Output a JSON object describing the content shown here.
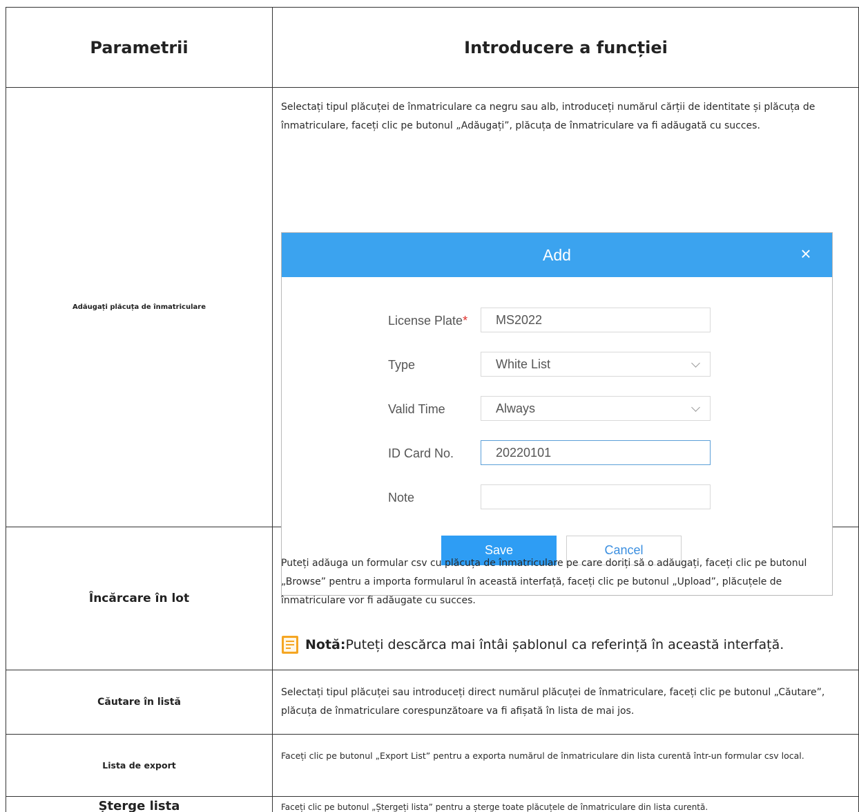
{
  "header": {
    "col1": "Parametrii",
    "col2": "Introducere a funcției"
  },
  "rows": [
    {
      "name": "Adăugați plăcuța de înmatriculare",
      "description": "Selectați tipul plăcuței de înmatriculare ca negru sau alb, introduceți numărul cărții de identitate și plăcuța de înmatriculare, faceți clic pe butonul „Adăugați”, plăcuța de înmatriculare va fi adăugată cu succes."
    },
    {
      "name": "Încărcare în lot",
      "description": "Puteți adăuga un formular csv cu plăcuța de înmatriculare pe care doriți să o adăugați, faceți clic pe butonul „Browse” pentru a importa formularul în această interfață, faceți clic pe butonul „Upload”, plăcuțele de înmatriculare vor fi adăugate cu succes.",
      "note_label": "Notă:",
      "note_text": "Puteți descărca mai întâi șablonul ca referință în această interfață."
    },
    {
      "name": "Căutare în listă",
      "description": "Selectați tipul plăcuței sau introduceți direct numărul plăcuței de înmatriculare, faceți clic pe butonul „Căutare”, plăcuța de înmatriculare corespunzătoare va fi afișată în lista de mai jos."
    },
    {
      "name": "Lista de export",
      "description": "Faceți clic pe butonul „Export List” pentru a exporta numărul de înmatriculare din lista curentă într-un formular csv local."
    },
    {
      "name": "Șterge lista",
      "description": "Faceți clic pe butonul „Ștergeți lista” pentru a șterge toate plăcuțele de înmatriculare din lista curentă."
    }
  ],
  "dialog": {
    "title": "Add",
    "close_icon": "×",
    "fields": [
      {
        "label": "License Plate",
        "required_mark": "*",
        "value": "MS2022"
      },
      {
        "label": "Type",
        "value": "White List"
      },
      {
        "label": "Valid Time",
        "value": "Always"
      },
      {
        "label": "ID Card No.",
        "value": "20220101"
      },
      {
        "label": "Note",
        "value": ""
      }
    ],
    "save_label": "Save",
    "cancel_label": "Cancel"
  },
  "colors": {
    "dialog_header": "#3ba3ef",
    "save_button": "#2e9df4",
    "note_icon": "#f5a623"
  }
}
